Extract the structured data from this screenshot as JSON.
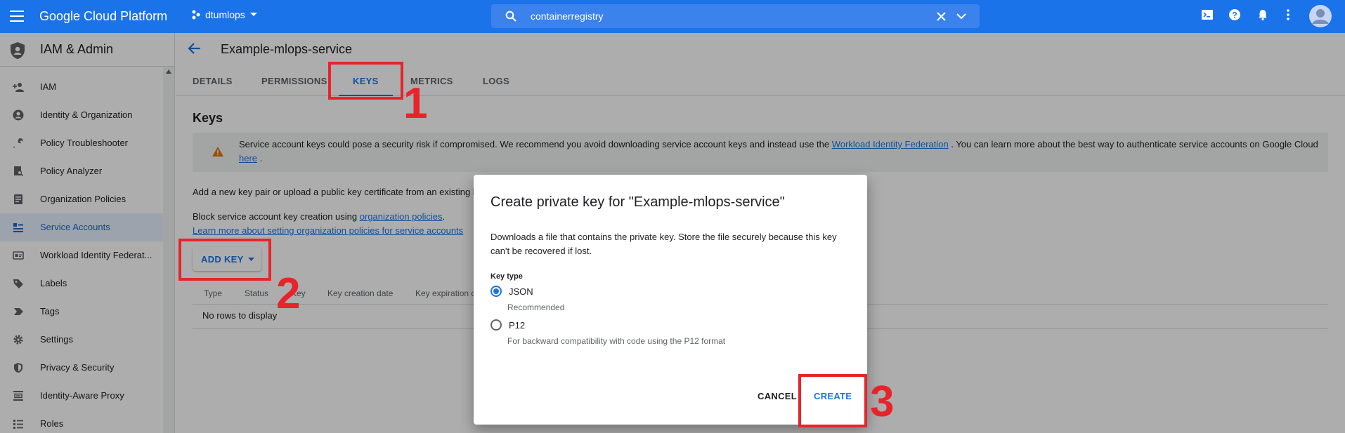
{
  "topbar": {
    "menu_icon": "hamburger-icon",
    "brand": "Google Cloud Platform",
    "project": "dtumlops",
    "search_value": "containerregistry"
  },
  "sidebar": {
    "title": "IAM & Admin",
    "items": [
      {
        "label": "IAM",
        "icon": "person-add-icon"
      },
      {
        "label": "Identity & Organization",
        "icon": "account-circle-icon"
      },
      {
        "label": "Policy Troubleshooter",
        "icon": "wrench-icon"
      },
      {
        "label": "Policy Analyzer",
        "icon": "document-search-icon"
      },
      {
        "label": "Organization Policies",
        "icon": "list-doc-icon"
      },
      {
        "label": "Service Accounts",
        "icon": "service-account-icon"
      },
      {
        "label": "Workload Identity Federat...",
        "icon": "id-card-icon"
      },
      {
        "label": "Labels",
        "icon": "label-icon"
      },
      {
        "label": "Tags",
        "icon": "tag-arrow-icon"
      },
      {
        "label": "Settings",
        "icon": "gear-icon"
      },
      {
        "label": "Privacy & Security",
        "icon": "shield-icon"
      },
      {
        "label": "Identity-Aware Proxy",
        "icon": "proxy-icon"
      },
      {
        "label": "Roles",
        "icon": "roles-icon"
      }
    ]
  },
  "main": {
    "title": "Example-mlops-service",
    "tabs": [
      "DETAILS",
      "PERMISSIONS",
      "KEYS",
      "METRICS",
      "LOGS"
    ],
    "section_title": "Keys",
    "warning": {
      "text_before": "Service account keys could pose a security risk if compromised. We recommend you avoid downloading service account keys and instead use the ",
      "link1": "Workload Identity Federation",
      "text_middle": " . You can learn more about the best way to authenticate service accounts on Google Cloud ",
      "link2": "here",
      "text_after": " ."
    },
    "add_key_text": "Add a new key pair or upload a public key certificate from an existing l",
    "block_text": "Block service account key creation using ",
    "block_link": "organization policies",
    "block_after": ".",
    "learn_link": "Learn more about setting organization policies for service accounts",
    "add_key_button": "ADD KEY",
    "table_headers": [
      "Type",
      "Status",
      "Key",
      "Key creation date",
      "Key expiration d"
    ],
    "empty_text": "No rows to display"
  },
  "dialog": {
    "title": "Create private key for \"Example-mlops-service\"",
    "description": "Downloads a file that contains the private key. Store the file securely because this key can't be recovered if lost.",
    "key_type_label": "Key type",
    "options": [
      {
        "label": "JSON",
        "sub": "Recommended",
        "selected": true
      },
      {
        "label": "P12",
        "sub": "For backward compatibility with code using the P12 format",
        "selected": false
      }
    ],
    "cancel": "CANCEL",
    "create": "CREATE"
  },
  "annotations": [
    "1",
    "2",
    "3"
  ],
  "colors": {
    "accent": "#1a73e8",
    "annotation": "#e8232b"
  }
}
